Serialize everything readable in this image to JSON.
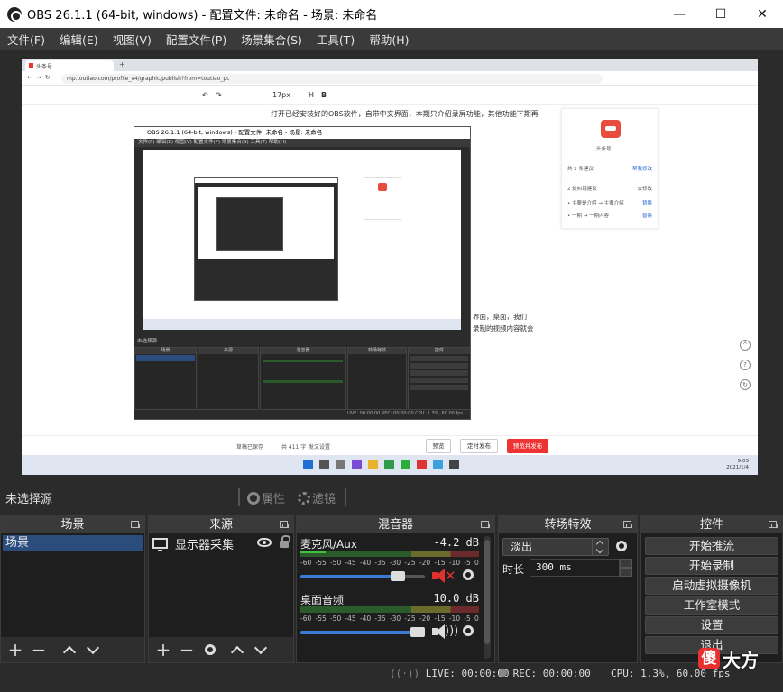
{
  "window": {
    "title": "OBS 26.1.1 (64-bit, windows) - 配置文件: 未命名 - 场景: 未命名",
    "minimize": "—",
    "maximize": "☐",
    "close": "✕"
  },
  "menu": [
    "文件(F)",
    "编辑(E)",
    "视图(V)",
    "配置文件(P)",
    "场景集合(S)",
    "工具(T)",
    "帮助(H)"
  ],
  "preview": {
    "browser_tab": "头条号",
    "url": "mp.toutiao.com/profile_v4/graphic/publish?from=toutiao_pc",
    "toolbar_font_size": "17px",
    "article_line": "打开已经安装好的OBS软件，自带中文界面，本期只介绍录屏功能，其他功能下期再",
    "article_line_2": "界面，桌面，我们",
    "article_line_3": "录制的视频内容就会",
    "card_name": "头条号",
    "card_line_1": "共 2 条建议",
    "card_line_1_link": "帮我修改",
    "card_line_2": "2 处纠错建议",
    "card_line_2_link": "去修改",
    "card_line_3": "• 主要是介绍 → 主要介绍",
    "card_line_3_link": "替换",
    "card_line_4": "• 一期 → 一期内容",
    "card_line_4_link": "替换",
    "footer_autosave": "草稿已保存",
    "footer_count": "共 411 字",
    "footer_tip": "发文设置",
    "btn_preview": "预览",
    "btn_schedule": "定时发布",
    "btn_publish": "预览并发布",
    "clock_time": "9:03",
    "clock_date": "2021/1/4"
  },
  "nested": {
    "title": "OBS 26.1.1 (64-bit, windows) - 配置文件: 未命名 - 场景: 未命名",
    "menu": "文件(F)  编辑(E)  视图(V)  配置文件(P)  场景集合(S)  工具(T)  帮助(H)",
    "source_bar": "未选择源",
    "dock_titles": [
      "场景",
      "来源",
      "混音器",
      "转场特效",
      "控件"
    ],
    "status": "LIVE: 00:00:00   REC: 00:00:00   CPU: 1.3%, 60.00 fps"
  },
  "source_toolbar": {
    "no_selection": "未选择源",
    "properties": "属性",
    "filters": "滤镜"
  },
  "docks": {
    "scenes": {
      "title": "场景",
      "items": [
        "场景"
      ]
    },
    "sources": {
      "title": "来源",
      "items": [
        "显示器采集"
      ]
    },
    "mixer": {
      "title": "混音器",
      "channels": [
        {
          "name": "麦克风/Aux",
          "db": "-4.2 dB",
          "volume": 0.78,
          "muted": true
        },
        {
          "name": "桌面音频",
          "db": "10.0 dB",
          "volume": 0.94,
          "muted": false
        }
      ],
      "ticks": [
        "-60",
        "-55",
        "-50",
        "-45",
        "-40",
        "-35",
        "-30",
        "-25",
        "-20",
        "-15",
        "-10",
        "-5",
        "0"
      ]
    },
    "transitions": {
      "title": "转场特效",
      "selected": "淡出",
      "duration_label": "时长",
      "duration_value": "300 ms"
    },
    "controls": {
      "title": "控件",
      "buttons": [
        "开始推流",
        "开始录制",
        "启动虚拟摄像机",
        "工作室模式",
        "设置",
        "退出"
      ]
    }
  },
  "status": {
    "live": "LIVE: 00:00:00",
    "rec": "REC: 00:00:00",
    "cpu": "CPU: 1.3%, 60.00 fps"
  },
  "watermark": {
    "logo": "傻",
    "text": "大方"
  },
  "colors": {
    "accent": "#2b4d7e",
    "slider": "#3a7ad5",
    "mute_red": "#e03030",
    "publish_red": "#e33333"
  }
}
